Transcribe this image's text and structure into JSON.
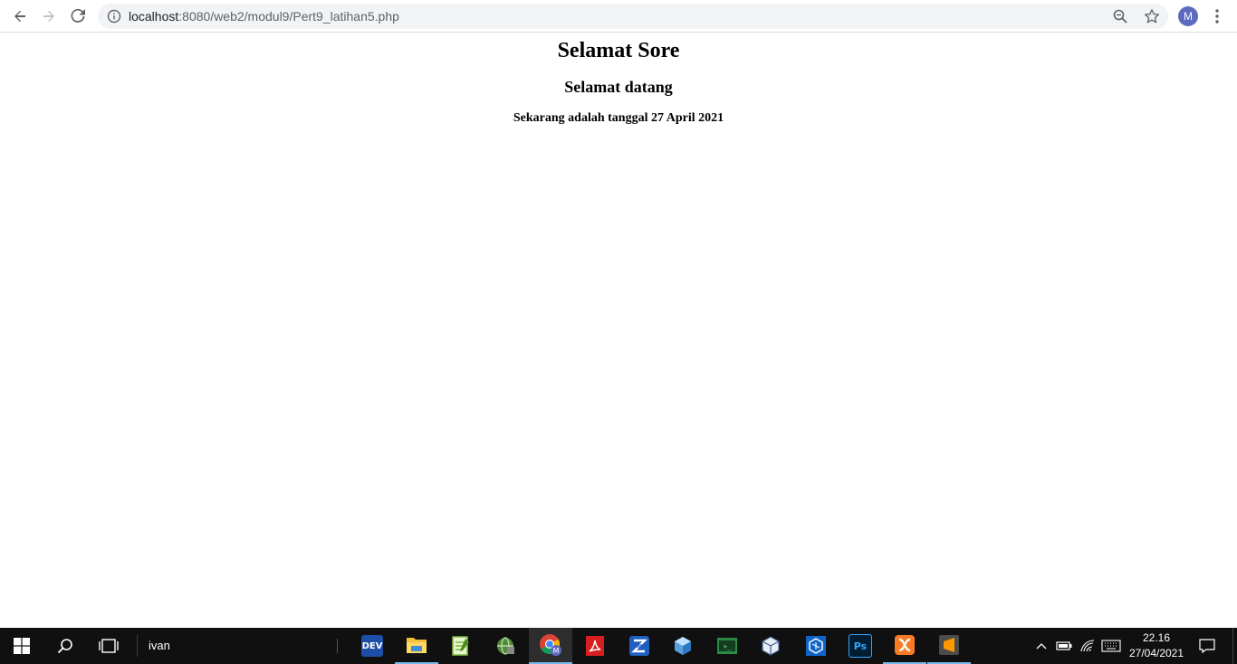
{
  "browser": {
    "url_host": "localhost",
    "url_rest": ":8080/web2/modul9/Pert9_latihan5.php",
    "profile_initial": "M",
    "icons": {
      "back": "arrow-left-icon",
      "forward": "arrow-right-icon",
      "reload": "reload-icon",
      "info": "info-icon",
      "zoom": "zoom-icon",
      "bookmark": "star-icon",
      "menu": "kebab-menu-icon"
    }
  },
  "page": {
    "heading1": "Selamat Sore",
    "heading2": "Selamat datang",
    "heading3": "Sekarang adalah tanggal 27 April 2021"
  },
  "taskbar": {
    "search_text": "ivan",
    "apps": [
      {
        "name": "Dev-C++",
        "icon": "devcpp-icon",
        "label": "DEV",
        "color": "#1e4fa8"
      },
      {
        "name": "File Explorer",
        "icon": "folder-icon",
        "label": "",
        "color": "#f3c03c"
      },
      {
        "name": "Notepad++",
        "icon": "notepad-icon",
        "label": "",
        "color": "#7cba3c"
      },
      {
        "name": "Network App",
        "icon": "globe-tool-icon",
        "label": "",
        "color": "#4f8a3a"
      },
      {
        "name": "Google Chrome",
        "icon": "chrome-icon",
        "label": "",
        "color": "#db4437"
      },
      {
        "name": "Acrobat Reader",
        "icon": "pdf-icon",
        "label": "",
        "color": "#d81e1e"
      },
      {
        "name": "Zend Studio",
        "icon": "zend-icon",
        "label": "",
        "color": "#1f5fbf"
      },
      {
        "name": "3D App",
        "icon": "cube-icon",
        "label": "",
        "color": "#5aa0e0"
      },
      {
        "name": "Terminal App",
        "icon": "terminal-icon",
        "label": "",
        "color": "#2d8a45"
      },
      {
        "name": "VirtualBox",
        "icon": "virtualbox-icon",
        "label": "",
        "color": "#9fb6d6"
      },
      {
        "name": "Editor App",
        "icon": "editor-icon",
        "label": "",
        "color": "#0e64c8"
      },
      {
        "name": "Photoshop",
        "icon": "photoshop-icon",
        "label": "Ps",
        "color": "#001d34"
      },
      {
        "name": "XAMPP",
        "icon": "xampp-icon",
        "label": "",
        "color": "#fb7a24"
      },
      {
        "name": "Sublime Text",
        "icon": "sublime-icon",
        "label": "",
        "color": "#ff9800"
      }
    ],
    "time": "22.16",
    "date": "27/04/2021"
  }
}
